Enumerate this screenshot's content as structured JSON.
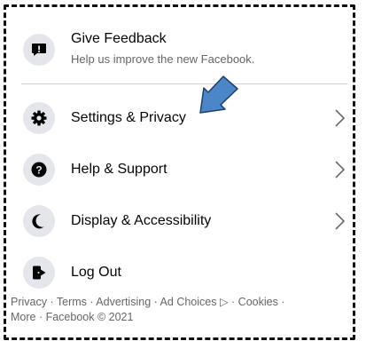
{
  "feedback": {
    "title": "Give Feedback",
    "subtitle": "Help us improve the new Facebook.",
    "icon": "feedback-icon"
  },
  "menu_items": [
    {
      "label": "Settings & Privacy",
      "icon": "gear-icon"
    },
    {
      "label": "Help & Support",
      "icon": "question-icon"
    },
    {
      "label": "Display & Accessibility",
      "icon": "moon-icon"
    },
    {
      "label": "Log Out",
      "icon": "logout-icon"
    }
  ],
  "footer": {
    "line1": "Privacy · Terms · Advertising · Ad Choices ▷ · Cookies ·",
    "line2": "More · Facebook © 2021"
  },
  "colors": {
    "icon_bg": "#e4e6eb",
    "annotation_arrow": "#4a86c8"
  }
}
